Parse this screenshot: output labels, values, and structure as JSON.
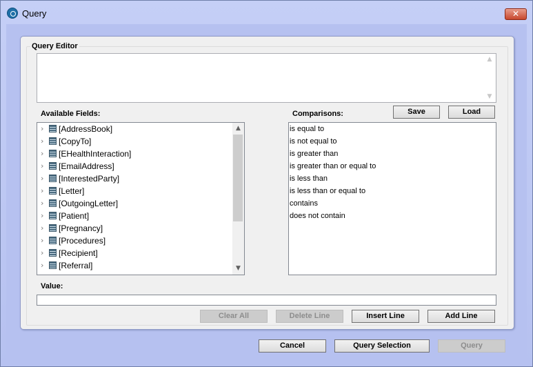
{
  "window": {
    "title": "Query",
    "close_label": "✕"
  },
  "editor": {
    "group_label": "Query Editor",
    "value": ""
  },
  "fields": {
    "label": "Available Fields:",
    "items": [
      "[AddressBook]",
      "[CopyTo]",
      "[EHealthInteraction]",
      "[EmailAddress]",
      "[InterestedParty]",
      "[Letter]",
      "[OutgoingLetter]",
      "[Patient]",
      "[Pregnancy]",
      "[Procedures]",
      "[Recipient]",
      "[Referral]"
    ]
  },
  "comparisons": {
    "label": "Comparisons:",
    "items": [
      "is equal to",
      "is not equal to",
      "is greater than",
      "is greater than or equal to",
      "is less than",
      "is less than or equal to",
      "contains",
      "does not contain"
    ]
  },
  "buttons": {
    "save": "Save",
    "load": "Load",
    "clear_all": "Clear All",
    "delete_line": "Delete Line",
    "insert_line": "Insert Line",
    "add_line": "Add Line",
    "cancel": "Cancel",
    "query_selection": "Query Selection",
    "query": "Query"
  },
  "value": {
    "label": "Value:",
    "value": ""
  },
  "icons": {
    "tree_expand": "chevron-right-icon",
    "field": "table-icon"
  }
}
